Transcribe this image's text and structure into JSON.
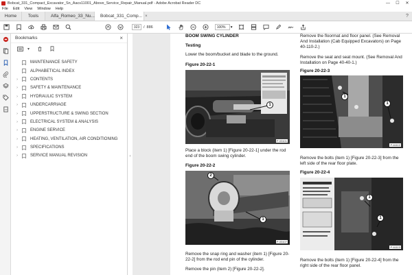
{
  "window": {
    "title": "Bobcat_331_Compact_Excavator_Sn_Aacs11001_Above_Service_Repair_Manual.pdf - Adobe Acrobat Reader DC",
    "minimize": "—",
    "maximize": "☐",
    "close": "✕"
  },
  "menu": [
    "File",
    "Edit",
    "View",
    "Window",
    "Help"
  ],
  "tabs": {
    "home": "Home",
    "tools": "Tools",
    "doc1": "Alfa_Romeo_33_Nu...",
    "doc2": "Bobcat_331_Comp...",
    "close": "×",
    "help": "?"
  },
  "toolbar": {
    "current_page": "323",
    "page_sep": "/",
    "total_pages": "886",
    "zoom": "100%",
    "zoom_caret": "▾"
  },
  "bookmarks": {
    "title": "Bookmarks",
    "close": "×",
    "options_caret": "▾",
    "items": [
      {
        "label": "MAINTENANCE SAFETY",
        "expandable": false
      },
      {
        "label": "ALPHABETICAL INDEX",
        "expandable": false
      },
      {
        "label": "CONTENTS",
        "expandable": true
      },
      {
        "label": "SAFETY & MAINTENANCE",
        "expandable": true
      },
      {
        "label": "HYDRAULIC SYSTEM",
        "expandable": true
      },
      {
        "label": "UNDERCARRIAGE",
        "expandable": true
      },
      {
        "label": "UPPERSTRUCTURE & SWING SECTION",
        "expandable": true
      },
      {
        "label": "ELECTRICAL SYSTEM & ANALYSIS",
        "expandable": true
      },
      {
        "label": "ENGINE SERVICE",
        "expandable": true
      },
      {
        "label": "HEATING, VENTILATION, AIR CONDITIONING",
        "expandable": true
      },
      {
        "label": "SPECIFICATIONS",
        "expandable": true
      },
      {
        "label": "SERVICE MANUAL REVISION",
        "expandable": true
      }
    ],
    "chevron": "›",
    "collapse_handle": "‹"
  },
  "document": {
    "left": {
      "section_title": "BOOM SWING CYLINDER",
      "subtitle": "Testing",
      "intro": "Lower the boom/bucket and blade to the ground.",
      "fig1_label": "Figure 20-22-1",
      "fig1_code": "P-03101",
      "fig1_callout": "1",
      "para1": "Place a block (item 1) [Figure 20-22-1] under the rod end of the boom swing cylinder.",
      "fig2_label": "Figure 20-22-2",
      "fig2_code": "P-03107",
      "fig2_callout_a": "2",
      "fig2_callout_b": "1",
      "para2": "Remove the snap ring and washer (item 1) [Figure 20-22-2] from the rod end pin of the cylinder.",
      "para3": "Remove the pin (item 2) [Figure 20-22-2]."
    },
    "right": {
      "para1": "Remove the floormat and floor panel. (See Removal And Installation (Cab Equipped Excavators) on Page 40-110-2.)",
      "para2": "Remove the seat and seat mount. (See Removal And Installation on Page 40-40-1.)",
      "fig3_label": "Figure 20-22-3",
      "fig3_code": "P-61112",
      "fig3_callout": "1",
      "para3": "Remove the bolts (item 1) [Figure 20-22-3] from the left side of the rear floor plate.",
      "fig4_label": "Figure 20-22-4",
      "fig4_code": "P-61113",
      "fig4_callout": "1",
      "para4": "Remove the bolts (item 1) [Figure 20-22-4] from the right side of the rear floor panel."
    }
  },
  "colors": {
    "acrobat_red": "#c8201a",
    "tab_bar": "#e9e9e9",
    "viewer_bg": "#eaeaea"
  }
}
